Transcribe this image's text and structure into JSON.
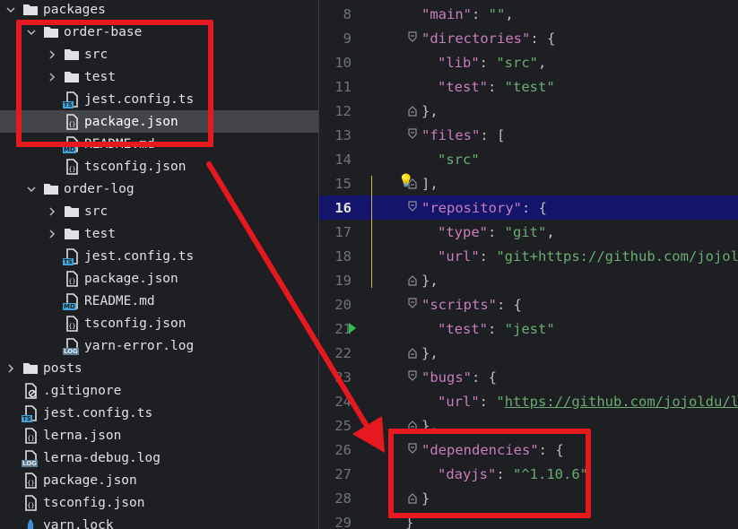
{
  "tree": {
    "items": [
      {
        "label": "packages",
        "type": "folder",
        "chevron": "down",
        "depth": 0
      },
      {
        "label": "order-base",
        "type": "folder",
        "chevron": "down",
        "depth": 1
      },
      {
        "label": "src",
        "type": "folder",
        "chevron": "right",
        "depth": 2
      },
      {
        "label": "test",
        "type": "folder",
        "chevron": "right",
        "depth": 2
      },
      {
        "label": "jest.config.ts",
        "type": "ts",
        "depth": 2
      },
      {
        "label": "package.json",
        "type": "json",
        "depth": 2,
        "selected": true
      },
      {
        "label": "README.md",
        "type": "md",
        "depth": 2
      },
      {
        "label": "tsconfig.json",
        "type": "json",
        "depth": 2
      },
      {
        "label": "order-log",
        "type": "folder",
        "chevron": "down",
        "depth": 1
      },
      {
        "label": "src",
        "type": "folder",
        "chevron": "right",
        "depth": 2
      },
      {
        "label": "test",
        "type": "folder",
        "chevron": "right",
        "depth": 2
      },
      {
        "label": "jest.config.ts",
        "type": "ts",
        "depth": 2
      },
      {
        "label": "package.json",
        "type": "json",
        "depth": 2
      },
      {
        "label": "README.md",
        "type": "md",
        "depth": 2
      },
      {
        "label": "tsconfig.json",
        "type": "json",
        "depth": 2
      },
      {
        "label": "yarn-error.log",
        "type": "log",
        "depth": 2
      },
      {
        "label": "posts",
        "type": "folder",
        "chevron": "right",
        "depth": 0
      },
      {
        "label": ".gitignore",
        "type": "gitignore",
        "depth": 0
      },
      {
        "label": "jest.config.ts",
        "type": "ts",
        "depth": 0
      },
      {
        "label": "lerna.json",
        "type": "json",
        "depth": 0
      },
      {
        "label": "lerna-debug.log",
        "type": "log",
        "depth": 0
      },
      {
        "label": "package.json",
        "type": "json",
        "depth": 0
      },
      {
        "label": "tsconfig.json",
        "type": "json",
        "depth": 0
      },
      {
        "label": "yarn.lock",
        "type": "lock",
        "depth": 0
      }
    ],
    "badges": {
      "ts": "TS",
      "md": "MD",
      "log": "LOG"
    }
  },
  "editor": {
    "current_line": "16",
    "lines": [
      {
        "n": "8",
        "tokens": [
          {
            "t": "\"main\"",
            "c": "k"
          },
          {
            "t": ": ",
            "c": "p"
          },
          {
            "t": "\"\"",
            "c": "s"
          },
          {
            "t": ",",
            "c": "p"
          }
        ],
        "indent": 1
      },
      {
        "n": "9",
        "tokens": [
          {
            "t": "\"directories\"",
            "c": "k"
          },
          {
            "t": ": {",
            "c": "p"
          }
        ],
        "indent": 1,
        "fold": "open"
      },
      {
        "n": "10",
        "tokens": [
          {
            "t": "\"lib\"",
            "c": "k"
          },
          {
            "t": ": ",
            "c": "p"
          },
          {
            "t": "\"src\"",
            "c": "s"
          },
          {
            "t": ",",
            "c": "p"
          }
        ],
        "indent": 2
      },
      {
        "n": "11",
        "tokens": [
          {
            "t": "\"test\"",
            "c": "k"
          },
          {
            "t": ": ",
            "c": "p"
          },
          {
            "t": "\"test\"",
            "c": "s"
          }
        ],
        "indent": 2
      },
      {
        "n": "12",
        "tokens": [
          {
            "t": "},",
            "c": "p"
          }
        ],
        "indent": 1,
        "fold": "close"
      },
      {
        "n": "13",
        "tokens": [
          {
            "t": "\"files\"",
            "c": "k"
          },
          {
            "t": ": [",
            "c": "p"
          }
        ],
        "indent": 1,
        "fold": "open"
      },
      {
        "n": "14",
        "tokens": [
          {
            "t": "\"src\"",
            "c": "s"
          }
        ],
        "indent": 2
      },
      {
        "n": "15",
        "tokens": [
          {
            "t": "],",
            "c": "p"
          }
        ],
        "indent": 1,
        "fold": "close",
        "bulb": true
      },
      {
        "n": "16",
        "tokens": [
          {
            "t": "\"repository\"",
            "c": "k"
          },
          {
            "t": ": {",
            "c": "p"
          }
        ],
        "indent": 1,
        "fold": "open",
        "current": true
      },
      {
        "n": "17",
        "tokens": [
          {
            "t": "\"type\"",
            "c": "k"
          },
          {
            "t": ": ",
            "c": "p"
          },
          {
            "t": "\"git\"",
            "c": "s"
          },
          {
            "t": ",",
            "c": "p"
          }
        ],
        "indent": 2
      },
      {
        "n": "18",
        "tokens": [
          {
            "t": "\"url\"",
            "c": "k"
          },
          {
            "t": ": ",
            "c": "p"
          },
          {
            "t": "\"git+https://github.com/jojoldu/",
            "c": "s"
          }
        ],
        "indent": 2
      },
      {
        "n": "19",
        "tokens": [
          {
            "t": "},",
            "c": "p"
          }
        ],
        "indent": 1,
        "fold": "close"
      },
      {
        "n": "20",
        "tokens": [
          {
            "t": "\"scripts\"",
            "c": "k"
          },
          {
            "t": ": {",
            "c": "p"
          }
        ],
        "indent": 1,
        "fold": "open"
      },
      {
        "n": "21",
        "tokens": [
          {
            "t": "\"test\"",
            "c": "k"
          },
          {
            "t": ": ",
            "c": "p"
          },
          {
            "t": "\"jest\"",
            "c": "s"
          }
        ],
        "indent": 2,
        "run": true
      },
      {
        "n": "22",
        "tokens": [
          {
            "t": "},",
            "c": "p"
          }
        ],
        "indent": 1,
        "fold": "close"
      },
      {
        "n": "23",
        "tokens": [
          {
            "t": "\"bugs\"",
            "c": "k"
          },
          {
            "t": ": {",
            "c": "p"
          }
        ],
        "indent": 1,
        "fold": "open"
      },
      {
        "n": "24",
        "tokens": [
          {
            "t": "\"url\"",
            "c": "k"
          },
          {
            "t": ": ",
            "c": "p"
          },
          {
            "t": "\"",
            "c": "s"
          },
          {
            "t": "https://github.com/jojoldu/lerna",
            "c": "u"
          }
        ],
        "indent": 2
      },
      {
        "n": "25",
        "tokens": [
          {
            "t": "},",
            "c": "p"
          }
        ],
        "indent": 1,
        "fold": "close"
      },
      {
        "n": "26",
        "tokens": [
          {
            "t": "\"dependencies\"",
            "c": "k"
          },
          {
            "t": ": {",
            "c": "p"
          }
        ],
        "indent": 1,
        "fold": "open"
      },
      {
        "n": "27",
        "tokens": [
          {
            "t": "\"dayjs\"",
            "c": "k"
          },
          {
            "t": ": ",
            "c": "p"
          },
          {
            "t": "\"^1.10.6\"",
            "c": "s"
          }
        ],
        "indent": 2
      },
      {
        "n": "28",
        "tokens": [
          {
            "t": "}",
            "c": "p"
          }
        ],
        "indent": 1,
        "fold": "close"
      },
      {
        "n": "29",
        "tokens": [
          {
            "t": "}",
            "c": "p"
          }
        ],
        "indent": 0
      }
    ]
  },
  "colors": {
    "annotation": "#e5191f",
    "current_line": "#14146a",
    "key": "#c77dbb",
    "string": "#6aab73"
  }
}
